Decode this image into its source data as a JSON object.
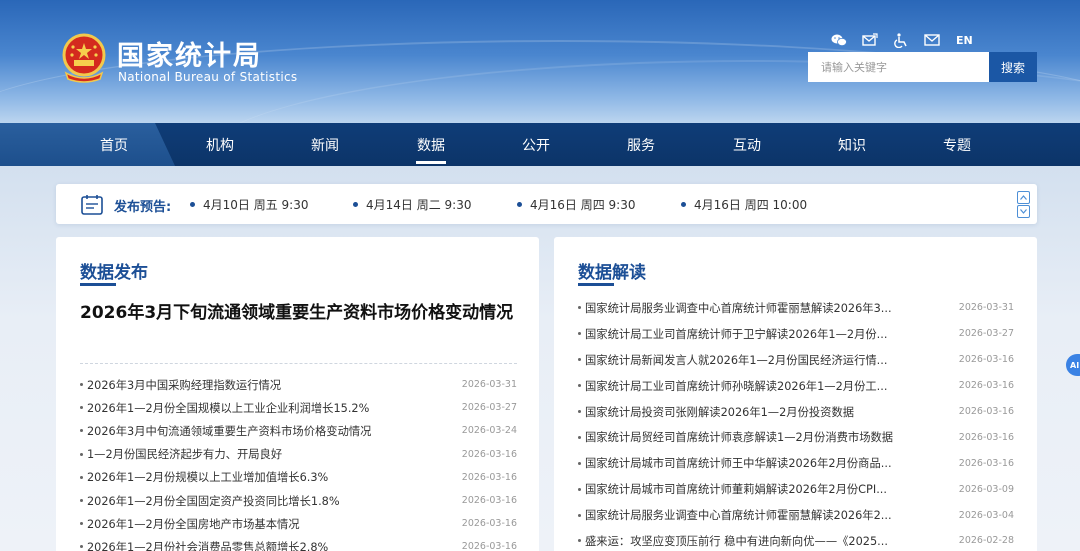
{
  "header": {
    "title_cn": "国家统计局",
    "title_en": "National Bureau of Statistics",
    "tools": [
      "wechat-icon",
      "mail-edit-icon",
      "accessibility-icon",
      "envelope-icon"
    ],
    "lang": "EN",
    "search_placeholder": "请输入关键字",
    "search_button": "搜索"
  },
  "nav": {
    "items": [
      "首页",
      "机构",
      "新闻",
      "数据",
      "公开",
      "服务",
      "互动",
      "知识",
      "专题"
    ],
    "active": "数据"
  },
  "release": {
    "label": "发布预告:",
    "items": [
      "4月10日 周五 9:30",
      "4月14日 周二 9:30",
      "4月16日 周四 9:30",
      "4月16日 周四 10:00"
    ]
  },
  "left_panel": {
    "title": "数据发布",
    "headline": "2026年3月下旬流通领域重要生产资料市场价格变动情况",
    "rows": [
      {
        "text": "2026年3月中国采购经理指数运行情况",
        "date": "2026-03-31"
      },
      {
        "text": "2026年1—2月份全国规模以上工业企业利润增长15.2%",
        "date": "2026-03-27"
      },
      {
        "text": "2026年3月中旬流通领域重要生产资料市场价格变动情况",
        "date": "2026-03-24"
      },
      {
        "text": "1—2月份国民经济起步有力、开局良好",
        "date": "2026-03-16"
      },
      {
        "text": "2026年1—2月份规模以上工业增加值增长6.3%",
        "date": "2026-03-16"
      },
      {
        "text": "2026年1—2月份全国固定资产投资同比增长1.8%",
        "date": "2026-03-16"
      },
      {
        "text": "2026年1—2月份全国房地产市场基本情况",
        "date": "2026-03-16"
      },
      {
        "text": "2026年1—2月份社会消费品零售总额增长2.8%",
        "date": "2026-03-16"
      }
    ]
  },
  "right_panel": {
    "title": "数据解读",
    "rows": [
      {
        "text": "国家统计局服务业调查中心首席统计师霍丽慧解读2026年3...",
        "date": "2026-03-31"
      },
      {
        "text": "国家统计局工业司首席统计师于卫宁解读2026年1—2月份...",
        "date": "2026-03-27"
      },
      {
        "text": "国家统计局新闻发言人就2026年1—2月份国民经济运行情...",
        "date": "2026-03-16"
      },
      {
        "text": "国家统计局工业司首席统计师孙晓解读2026年1—2月份工...",
        "date": "2026-03-16"
      },
      {
        "text": "国家统计局投资司张刚解读2026年1—2月份投资数据",
        "date": "2026-03-16"
      },
      {
        "text": "国家统计局贸经司首席统计师袁彦解读1—2月份消费市场数据",
        "date": "2026-03-16"
      },
      {
        "text": "国家统计局城市司首席统计师王中华解读2026年2月份商品...",
        "date": "2026-03-16"
      },
      {
        "text": "国家统计局城市司首席统计师董莉娟解读2026年2月份CPI...",
        "date": "2026-03-09"
      },
      {
        "text": "国家统计局服务业调查中心首席统计师霍丽慧解读2026年2...",
        "date": "2026-03-04"
      },
      {
        "text": "盛来运：攻坚应变顶压前行 稳中有进向新向优——《2025...",
        "date": "2026-02-28"
      }
    ]
  },
  "ai_badge": "AI"
}
